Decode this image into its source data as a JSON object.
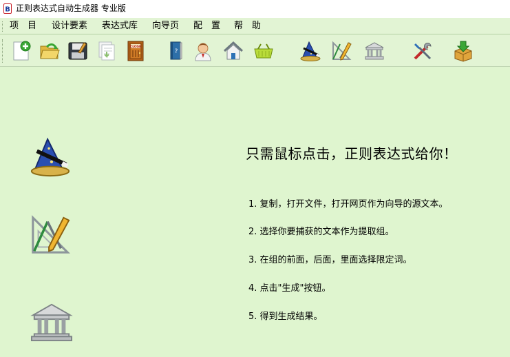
{
  "window": {
    "title": "正则表达式自动生成器 专业版"
  },
  "menu": [
    {
      "label": "项　目"
    },
    {
      "label": "设计要素"
    },
    {
      "label": "表达式库"
    },
    {
      "label": "向导页"
    },
    {
      "label": "配　置"
    },
    {
      "label": "帮　助"
    }
  ],
  "toolbar": {
    "buttons": [
      {
        "icon": "new-document-icon"
      },
      {
        "icon": "open-folder-icon"
      },
      {
        "icon": "save-disk-icon"
      },
      {
        "icon": "import-icon"
      },
      {
        "icon": "close-door-icon",
        "label": "CLOSE"
      },
      {
        "icon": "book-icon"
      },
      {
        "icon": "user-icon"
      },
      {
        "icon": "home-icon"
      },
      {
        "icon": "basket-icon"
      },
      {
        "icon": "wizard-hat-icon"
      },
      {
        "icon": "drafting-tools-icon"
      },
      {
        "icon": "library-icon"
      },
      {
        "icon": "tools-icon"
      },
      {
        "icon": "download-box-icon"
      }
    ]
  },
  "main": {
    "headline": "只需鼠标点击，正则表达式给你！",
    "steps": [
      "1. 复制，打开文件，打开网页作为向导的源文本。",
      "2. 选择你要捕获的文本作为提取组。",
      "3. 在组的前面，后面，里面选择限定词。",
      "4. 点击\"生成\"按钮。",
      "5. 得到生成结果。"
    ],
    "side_icons": [
      "wizard-hat-icon",
      "drafting-tools-icon",
      "library-icon"
    ]
  },
  "colors": {
    "background": "#dff5cf",
    "titlebar": "#ffffff",
    "accent_blue": "#2a4fb0",
    "accent_green": "#3aa635"
  }
}
